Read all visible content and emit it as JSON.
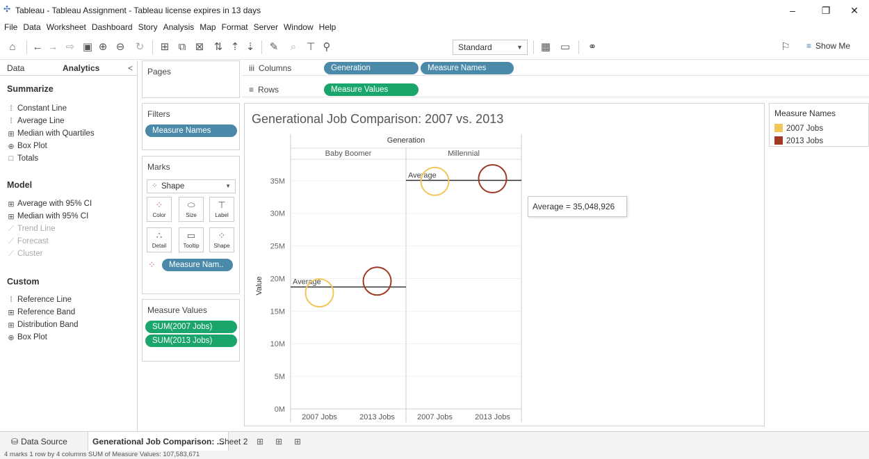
{
  "window": {
    "title": "Tableau - Tableau Assignment - Tableau license expires in 13 days",
    "minimize": "–",
    "restore": "❐",
    "close": "✕"
  },
  "menu": [
    "File",
    "Data",
    "Worksheet",
    "Dashboard",
    "Story",
    "Analysis",
    "Map",
    "Format",
    "Server",
    "Window",
    "Help"
  ],
  "toolbar": {
    "fit_select": "Standard",
    "show_me": "Show Me",
    "icons": [
      "home-icon",
      "back-icon",
      "forward-icon",
      "redo-icon",
      "save-icon",
      "new-datasource-icon",
      "pause-icon",
      "refresh-icon",
      "new-worksheet-icon",
      "duplicate-icon",
      "clear-icon",
      "swap-icon",
      "sort-asc-icon",
      "sort-desc-icon",
      "highlight-icon",
      "group-icon",
      "label-icon",
      "pin-icon",
      "chart-icon",
      "presentation-icon",
      "share-icon",
      "tooltip-icon"
    ]
  },
  "left_panel": {
    "tab_data": "Data",
    "tab_analytics": "Analytics",
    "collapse": "<",
    "summarize": {
      "heading": "Summarize",
      "items": [
        "Constant Line",
        "Average Line",
        "Median with Quartiles",
        "Box Plot",
        "Totals"
      ]
    },
    "model": {
      "heading": "Model",
      "items": [
        "Average with 95% CI",
        "Median with 95% CI",
        "Trend Line",
        "Forecast",
        "Cluster"
      ]
    },
    "custom": {
      "heading": "Custom",
      "items": [
        "Reference Line",
        "Reference Band",
        "Distribution Band",
        "Box Plot"
      ]
    }
  },
  "cards": {
    "pages": "Pages",
    "filters": "Filters",
    "filter_pill": "Measure Names",
    "marks": "Marks",
    "mark_type": "Shape",
    "mark_buttons": [
      "Color",
      "Size",
      "Label",
      "Detail",
      "Tooltip",
      "Shape"
    ],
    "marks_pill": "Measure Nam..",
    "measure_values": "Measure Values",
    "measure_pills": [
      "SUM(2007 Jobs)",
      "SUM(2013 Jobs)"
    ]
  },
  "shelves": {
    "columns_label": "Columns",
    "rows_label": "Rows",
    "columns_pills": [
      "Generation",
      "Measure Names"
    ],
    "rows_pills": [
      "Measure Values"
    ]
  },
  "chart_data": {
    "type": "scatter",
    "title": "Generational Job Comparison: 2007 vs. 2013",
    "column_header": "Generation",
    "panes": [
      "Baby Boomer",
      "Millennial"
    ],
    "categories": [
      "2007 Jobs",
      "2013 Jobs"
    ],
    "ylabel": "Value",
    "ylim": [
      0,
      38500000
    ],
    "yticks": [
      "0M",
      "5M",
      "10M",
      "15M",
      "20M",
      "25M",
      "30M",
      "35M"
    ],
    "series": [
      {
        "name": "2007 Jobs",
        "color": "#f1c75a",
        "values": [
          17800000,
          34900000
        ]
      },
      {
        "name": "2013 Jobs",
        "color": "#9e3a26",
        "values": [
          19600000,
          35300000
        ]
      }
    ],
    "reference_lines": [
      {
        "pane": "Baby Boomer",
        "label": "Average",
        "value": 18700000
      },
      {
        "pane": "Millennial",
        "label": "Average",
        "value": 35048926
      }
    ],
    "grid": true
  },
  "legend": {
    "title": "Measure Names",
    "items": [
      {
        "label": "2007 Jobs",
        "color": "#f1c75a"
      },
      {
        "label": "2013 Jobs",
        "color": "#9e3a26"
      }
    ]
  },
  "tooltip": "Average = 35,048,926",
  "tabs": {
    "data_source": "Data Source",
    "active": "Generational Job Comparison: ...",
    "sheet2": "Sheet 2"
  },
  "status": "4 marks    1 row by 4 columns    SUM of Measure Values: 107,583,671"
}
